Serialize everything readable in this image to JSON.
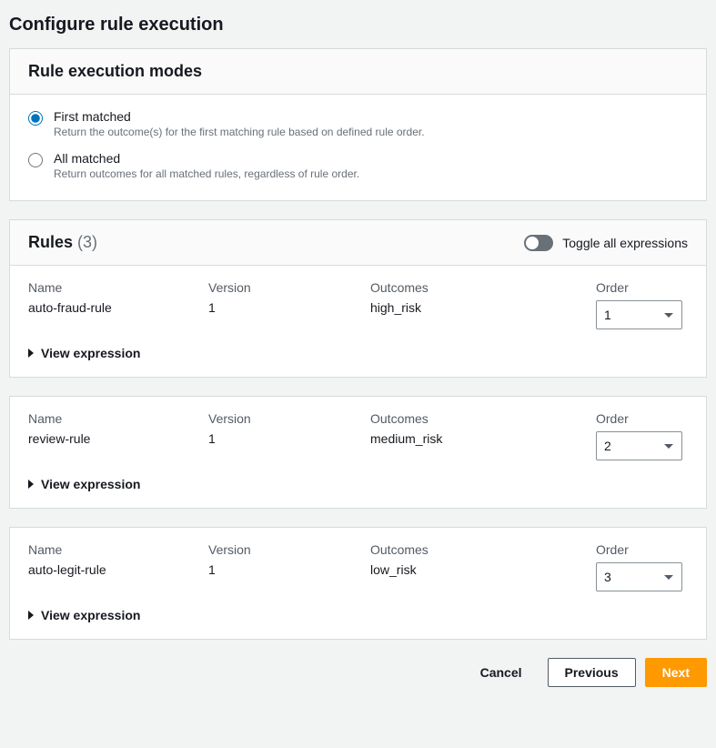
{
  "page": {
    "title": "Configure rule execution"
  },
  "modes": {
    "header": "Rule execution modes",
    "options": [
      {
        "id": "first",
        "label": "First matched",
        "description": "Return the outcome(s) for the first matching rule based on defined rule order.",
        "selected": true
      },
      {
        "id": "all",
        "label": "All matched",
        "description": "Return outcomes for all matched rules, regardless of rule order.",
        "selected": false
      }
    ]
  },
  "rules": {
    "header": "Rules",
    "count_label": "(3)",
    "toggle_label": "Toggle all expressions",
    "columns": {
      "name": "Name",
      "version": "Version",
      "outcomes": "Outcomes",
      "order": "Order"
    },
    "view_expression_label": "View expression",
    "items": [
      {
        "name": "auto-fraud-rule",
        "version": "1",
        "outcomes": "high_risk",
        "order": "1"
      },
      {
        "name": "review-rule",
        "version": "1",
        "outcomes": "medium_risk",
        "order": "2"
      },
      {
        "name": "auto-legit-rule",
        "version": "1",
        "outcomes": "low_risk",
        "order": "3"
      }
    ]
  },
  "footer": {
    "cancel": "Cancel",
    "previous": "Previous",
    "next": "Next"
  }
}
